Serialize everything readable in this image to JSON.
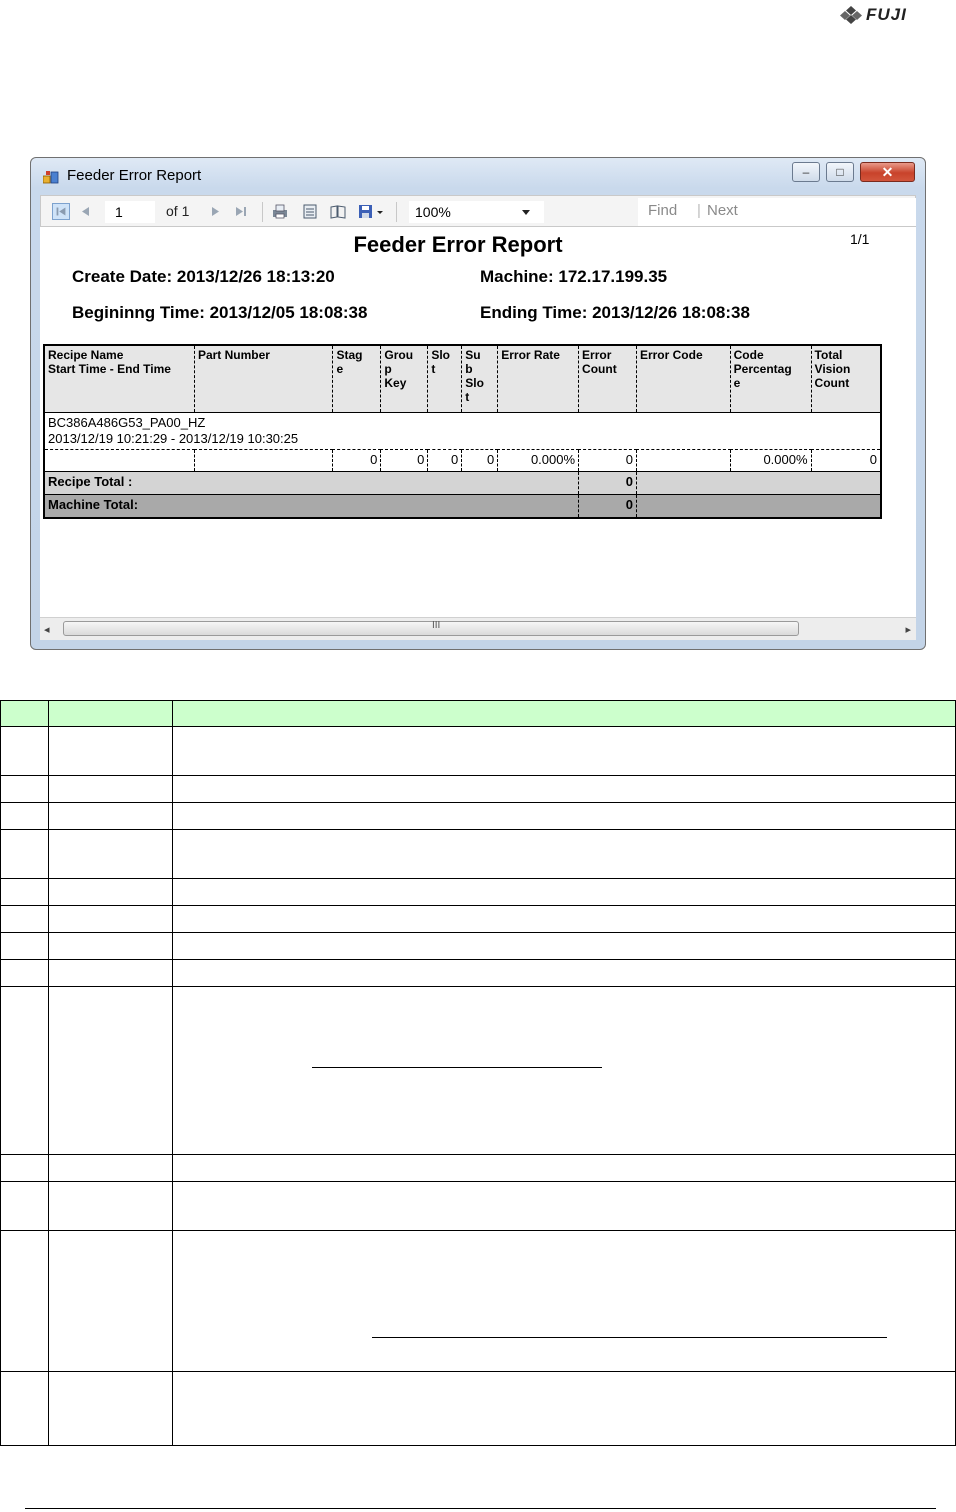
{
  "logo": {
    "text": "FUJI"
  },
  "window": {
    "title": "Feeder Error Report",
    "buttons": {
      "minimize": "–",
      "maximize": "□",
      "close": "✕"
    }
  },
  "toolbar": {
    "page_value": "1",
    "of_label": "of 1",
    "zoom": "100%",
    "find": "Find",
    "separator": "|",
    "next": "Next"
  },
  "report": {
    "title": "Feeder Error Report",
    "page_indicator": "1/1",
    "create_date": "Create Date: 2013/12/26 18:13:20",
    "machine": "Machine: 172.17.199.35",
    "begin_time": "Begininng Time: 2013/12/05 18:08:38",
    "end_time": "Ending Time: 2013/12/26 18:08:38",
    "columns": [
      [
        "Recipe Name",
        "Start Time - End Time"
      ],
      [
        "Part Number"
      ],
      [
        "Stag",
        "e"
      ],
      [
        "Grou",
        "p",
        "Key"
      ],
      [
        "Slo",
        "t"
      ],
      [
        "Su",
        "b",
        "Slo",
        "t"
      ],
      [
        "Error Rate"
      ],
      [
        "Error",
        "Count"
      ],
      [
        "Error Code"
      ],
      [
        "Code",
        "Percentag",
        "e"
      ],
      [
        "Total",
        "Vision",
        "Count"
      ]
    ],
    "group": {
      "recipe": "BC386A486G53_PA00_HZ",
      "time_range": "2013/12/19 10:21:29 - 2013/12/19 10:30:25"
    },
    "detail": {
      "recipe": "",
      "part": "",
      "stage": "0",
      "group_key": "0",
      "slot": "0",
      "sub_slot": "0",
      "error_rate": "0.000%",
      "error_count": "0",
      "error_code": "",
      "code_pct": "0.000%",
      "total_vision": "0"
    },
    "recipe_total": {
      "label": "Recipe Total :",
      "value": "0"
    },
    "machine_total": {
      "label": "Machine Total:",
      "value": "0"
    }
  },
  "scrollbar": {
    "left_arrow": "◂",
    "right_arrow": "▸",
    "grip": "III"
  },
  "colors": {
    "table_header": "#ccffcc",
    "recipe_total_bg": "#d4d4d4",
    "machine_total_bg": "#a9a9a9"
  }
}
